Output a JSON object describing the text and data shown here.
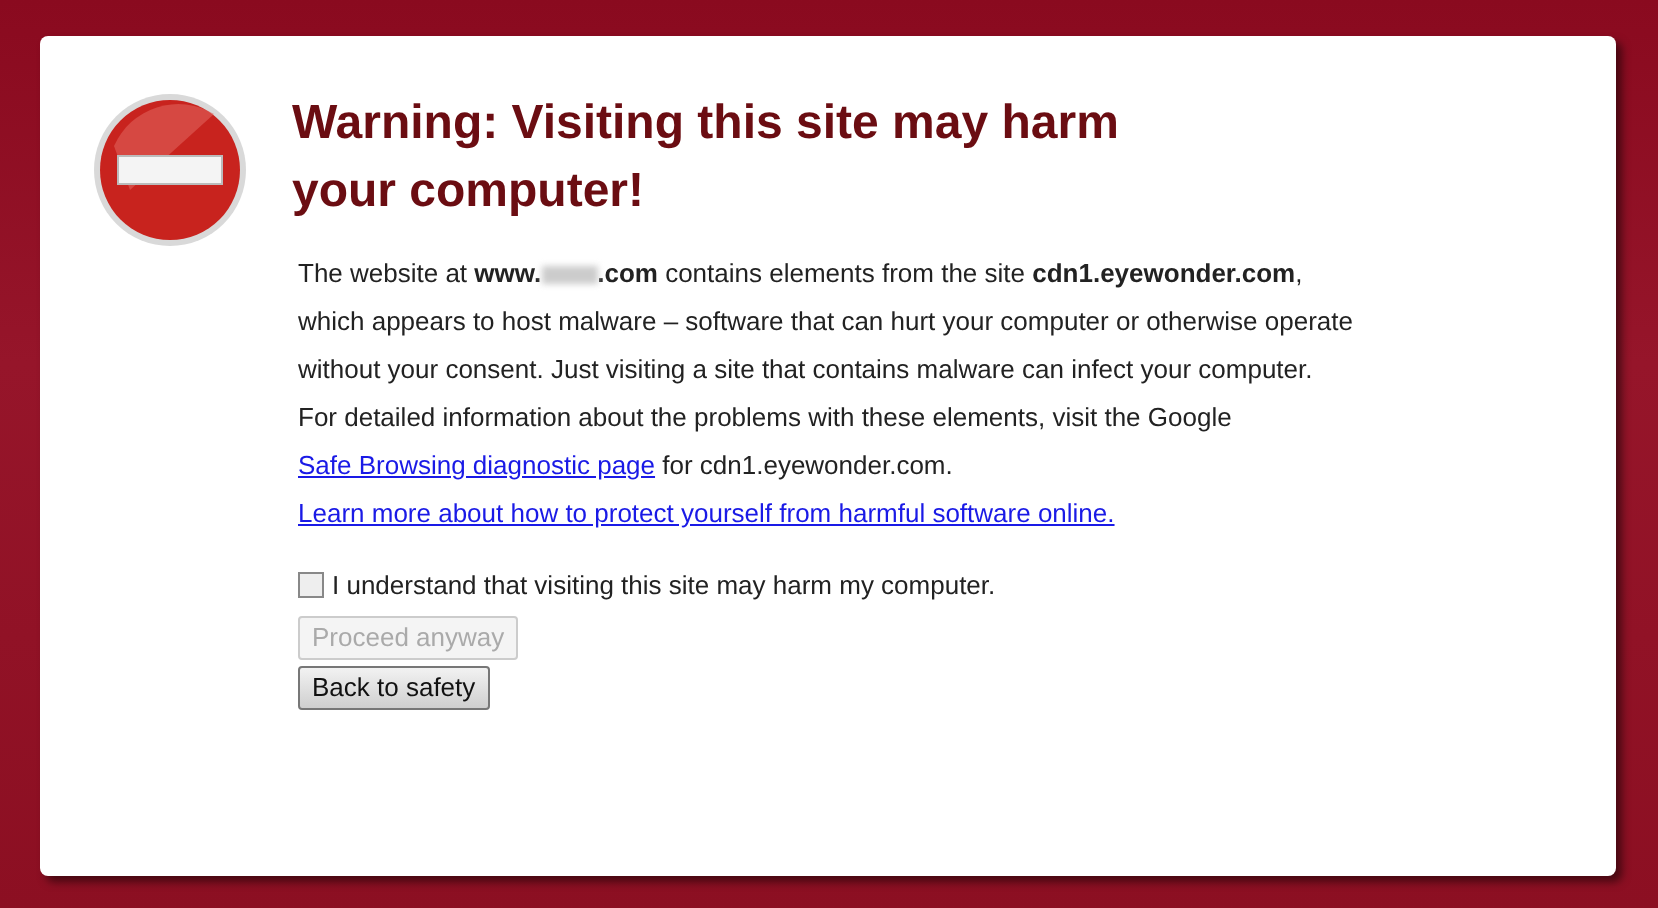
{
  "title": "Warning: Visiting this site may harm your computer!",
  "paragraphs": [
    {
      "before": "The website at **www.**",
      "redacted": true,
      "after": "**.com** contains elements from the site **cdn1.eyewonder.com**, which appears to host malware – software that can hurt your computer or otherwise operate without your consent. Just visiting a site that contains malware can infect your computer."
    },
    {
      "before": "For detailed information about the problems with these elements, visit the Google ",
      "link": "Safe Browsing diagnostic page",
      "after": " for cdn1.eyewonder.com."
    }
  ],
  "learn_more_link": "Learn more about how to protect yourself from harmful software online.",
  "consent": {
    "label": "I understand that visiting this site may harm my computer.",
    "checked": false
  },
  "buttons": [
    {
      "label": "Proceed anyway",
      "disabled": true
    },
    {
      "label": "Back to safety",
      "disabled": false
    }
  ]
}
